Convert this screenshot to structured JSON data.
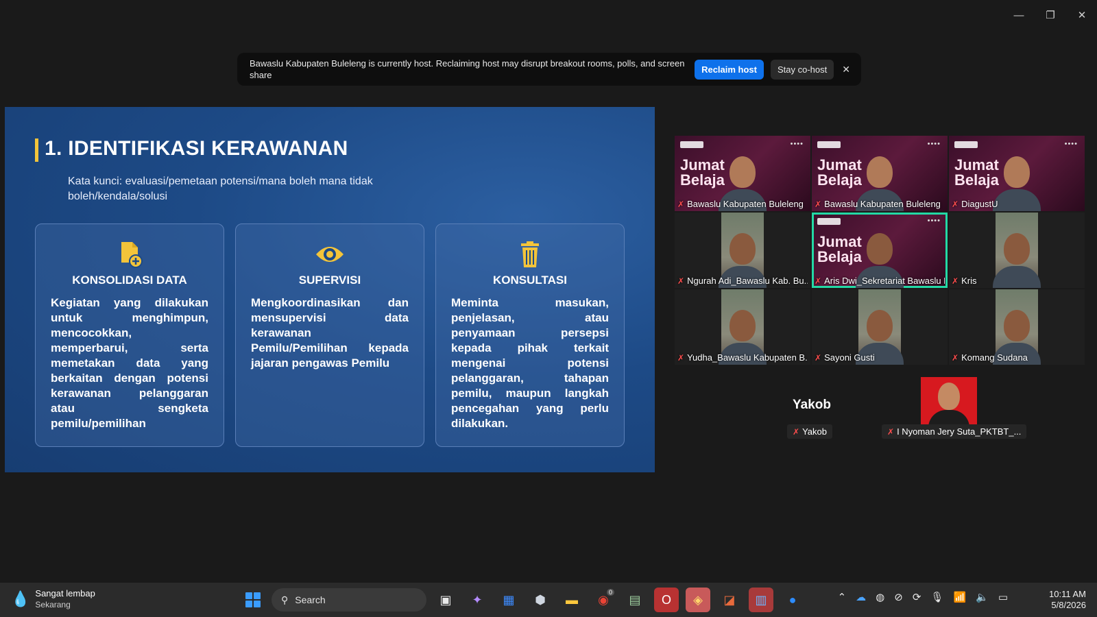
{
  "window": {
    "minimize": "—",
    "restore": "❐",
    "close": "✕"
  },
  "banner": {
    "message": "Bawaslu Kabupaten Buleleng is currently host. Reclaiming host may disrupt breakout rooms, polls, and screen share",
    "reclaim_label": "Reclaim host",
    "stay_label": "Stay co-host",
    "close_label": "✕"
  },
  "slide": {
    "title": "1. IDENTIFIKASI KERAWANAN",
    "subtitle": "Kata kunci: evaluasi/pemetaan potensi/mana boleh mana tidak boleh/kendala/solusi",
    "accent_color": "#f3c43a",
    "cards": [
      {
        "icon": "file-add-icon",
        "title": "KONSOLIDASI DATA",
        "body": "Kegiatan yang dilakukan untuk menghimpun, mencocokkan, memperbarui, serta memetakan data yang berkaitan dengan potensi kerawanan pelanggaran atau sengketa pemilu/pemilihan"
      },
      {
        "icon": "eye-icon",
        "title": "SUPERVISI",
        "body": "Mengkoordinasikan dan mensupervisi data kerawanan Pemilu/Pemilihan kepada jajaran pengawas Pemilu"
      },
      {
        "icon": "trash-icon",
        "title": "KONSULTASI",
        "body": "Meminta masukan, penjelasan, atau penyamaan persepsi kepada pihak terkait mengenai potensi pelanggaran, tahapan pemilu, maupun langkah pencegahan yang perlu dilakukan."
      }
    ]
  },
  "gallery": {
    "poster_text": "Jumat Belaja",
    "participants": [
      {
        "name": "Bawaslu Kabupaten Buleleng",
        "poster": true
      },
      {
        "name": "Bawaslu Kabupaten Buleleng",
        "poster": true
      },
      {
        "name": "DiagustU",
        "poster": true
      },
      {
        "name": "Ngurah Adi_Bawaslu Kab. Bu...",
        "poster": false
      },
      {
        "name": "Aris Dwi_Sekretariat Bawaslu Ka...",
        "poster": true,
        "active": true
      },
      {
        "name": "Kris",
        "poster": false
      },
      {
        "name": "Yudha_Bawaslu Kabupaten B...",
        "poster": false
      },
      {
        "name": "Sayoni Gusti",
        "poster": false
      },
      {
        "name": "Komang Sudana",
        "poster": false
      }
    ],
    "bottom": [
      {
        "big_name": "Yakob",
        "name": "Yakob"
      },
      {
        "name": "I Nyoman Jery Suta_PKTBT_..."
      }
    ],
    "active_color": "#23d9a5"
  },
  "taskbar": {
    "weather_title": "Sangat lembap",
    "weather_sub": "Sekarang",
    "search_label": "Search",
    "time": "10:11 AM",
    "date": "5/8/2026",
    "chrome_badge": "0"
  }
}
